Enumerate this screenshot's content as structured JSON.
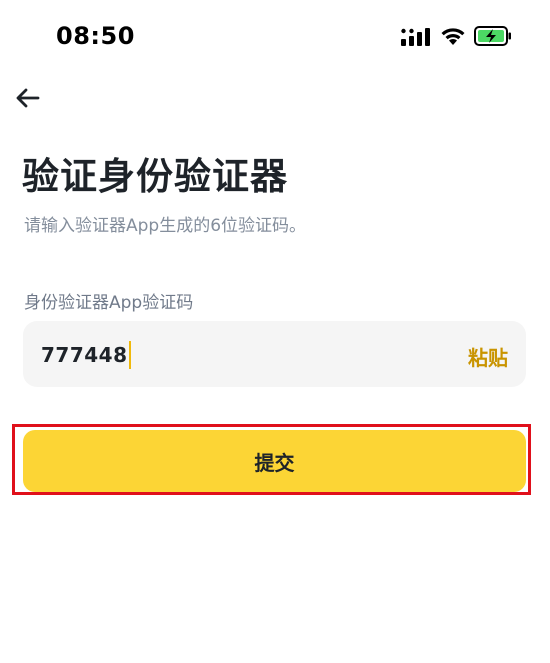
{
  "status_bar": {
    "time": "08:50",
    "icons": [
      "signal-icon",
      "wifi-icon",
      "battery-charging-icon"
    ],
    "battery_color": "#4cd964"
  },
  "header": {
    "back_icon": "arrow-left-icon"
  },
  "page": {
    "title": "验证身份验证器",
    "subtitle": "请输入验证器App生成的6位验证码。"
  },
  "form": {
    "field_label": "身份验证器App验证码",
    "code_value": "777448",
    "paste_label": "粘贴",
    "submit_label": "提交"
  },
  "colors": {
    "accent": "#fcd535",
    "paste_text": "#c99400",
    "caret": "#f0b90b",
    "highlight_border": "#e0101b",
    "input_bg": "#f5f5f5"
  }
}
